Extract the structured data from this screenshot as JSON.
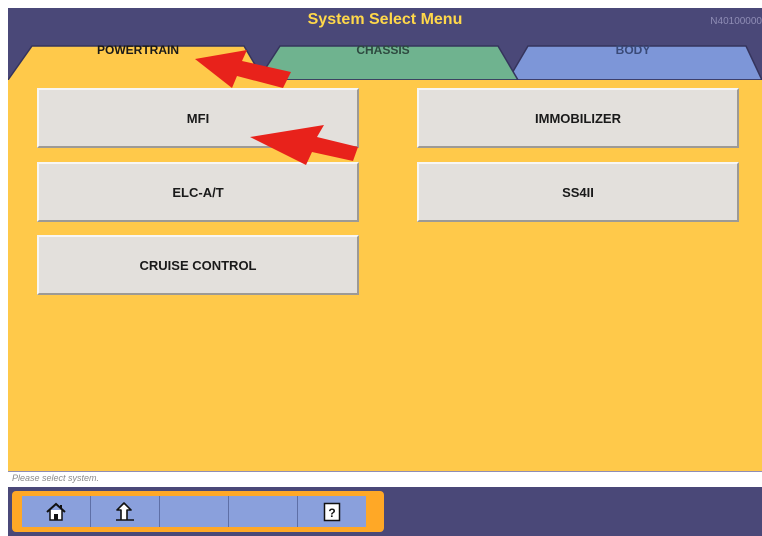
{
  "header": {
    "title": "System Select Menu",
    "screen_id": "N40100000"
  },
  "tabs": [
    {
      "label": "POWERTRAIN",
      "active": true,
      "color": "#ffc94a"
    },
    {
      "label": "CHASSIS",
      "active": false,
      "color": "#6fb38f"
    },
    {
      "label": "BODY",
      "active": false,
      "color": "#7d96d8"
    }
  ],
  "systems": [
    {
      "label": "MFI"
    },
    {
      "label": "IMMOBILIZER"
    },
    {
      "label": "ELC-A/T"
    },
    {
      "label": "SS4II"
    },
    {
      "label": "CRUISE CONTROL"
    }
  ],
  "status": {
    "message": "Please select system."
  },
  "toolbar": {
    "buttons": [
      {
        "icon": "home-icon"
      },
      {
        "icon": "back-arrow-icon"
      },
      {
        "icon": ""
      },
      {
        "icon": ""
      },
      {
        "icon": "help-icon",
        "label": "?"
      }
    ]
  },
  "colors": {
    "background": "#ffc94a",
    "frame": "#4a4878",
    "title": "#ffd84a",
    "annotation_arrow": "#e8221b"
  }
}
